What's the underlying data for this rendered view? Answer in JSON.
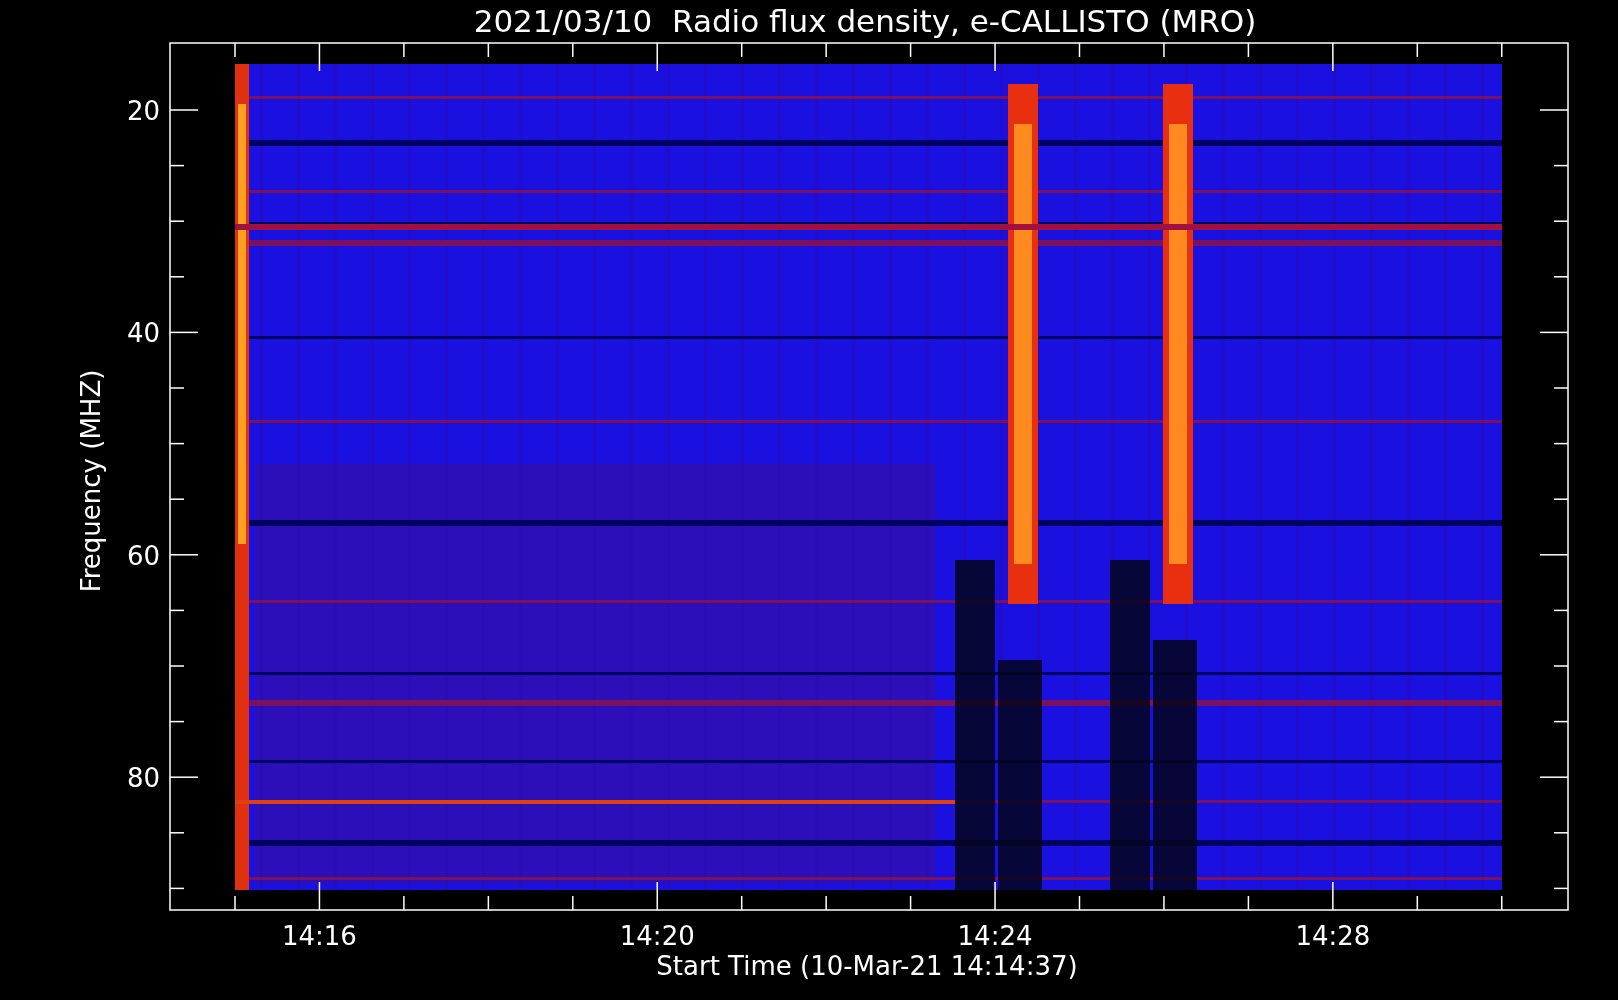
{
  "title": "2021/03/10  Radio flux density, e-CALLISTO (MRO)",
  "y_axis": {
    "label": "Frequency (MHZ)",
    "ticks": [
      "20",
      "40",
      "60",
      "80"
    ]
  },
  "x_axis": {
    "label": "Start Time (10-Mar-21 14:14:37)",
    "ticks": [
      "14:16",
      "14:20",
      "14:24",
      "14:28"
    ]
  }
}
